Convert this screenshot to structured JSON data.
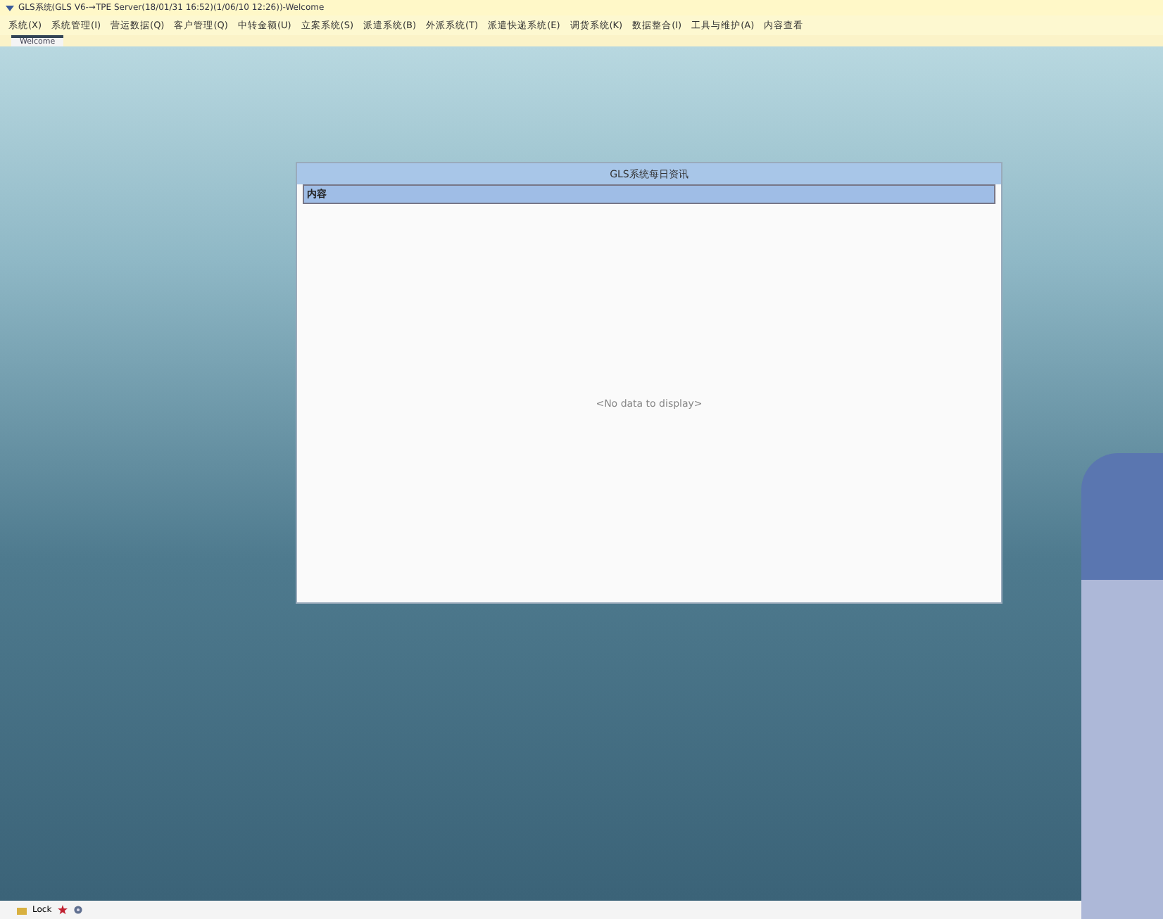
{
  "window": {
    "title": "GLS系统(GLS V6-→TPE Server(18/01/31 16:52)(1/06/10 12:26))-Welcome"
  },
  "menu": [
    {
      "label": "系统(X)"
    },
    {
      "label": "系统管理(I)"
    },
    {
      "label": "营运数据(Q)"
    },
    {
      "label": "客户管理(Q)"
    },
    {
      "label": "中转金额(U)"
    },
    {
      "label": "立案系统(S)"
    },
    {
      "label": "派遣系统(B)"
    },
    {
      "label": "外派系统(T)"
    },
    {
      "label": "派遣快递系统(E)"
    },
    {
      "label": "调货系统(K)"
    },
    {
      "label": "数据整合(I)"
    },
    {
      "label": "工具与维护(A)"
    },
    {
      "label": "内容查看"
    }
  ],
  "tabs": [
    {
      "label": "Welcome",
      "selected": true
    }
  ],
  "panel": {
    "title": "GLS系统每日资讯",
    "columns": [
      "内容"
    ],
    "empty_text": "<No data to display>"
  },
  "status_bar": {
    "lock": "Lock"
  }
}
